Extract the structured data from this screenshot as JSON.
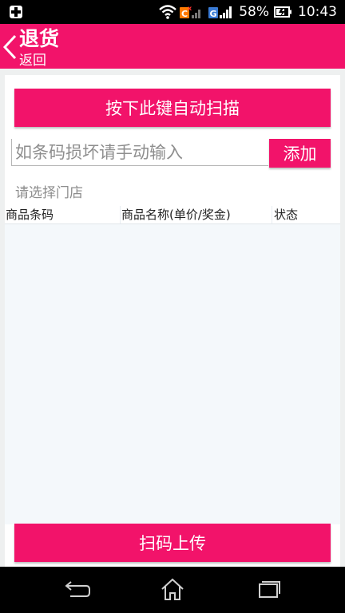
{
  "status_bar": {
    "battery_percent": "58%",
    "time": "10:43",
    "icons": [
      "usb-debug-icon",
      "wifi-icon",
      "carrier-c-icon",
      "signal-icon",
      "carrier-g-icon",
      "signal-icon",
      "battery-charging-icon"
    ]
  },
  "app_bar": {
    "title": "退货",
    "subtitle": "返回",
    "back_icon": "chevron-left-icon",
    "color": "#f2136a"
  },
  "scan": {
    "button_label": "按下此键自动扫描"
  },
  "barcode": {
    "placeholder": "如条码损坏请手动输入",
    "value": "",
    "add_label": "添加"
  },
  "store": {
    "label": "请选择门店"
  },
  "table": {
    "columns": [
      "商品条码",
      "商品名称(单价/奖金)",
      "状态"
    ],
    "rows": []
  },
  "upload": {
    "button_label": "扫码上传"
  },
  "nav": {
    "icons": [
      "nav-back-icon",
      "nav-home-icon",
      "nav-recent-apps-icon"
    ]
  }
}
